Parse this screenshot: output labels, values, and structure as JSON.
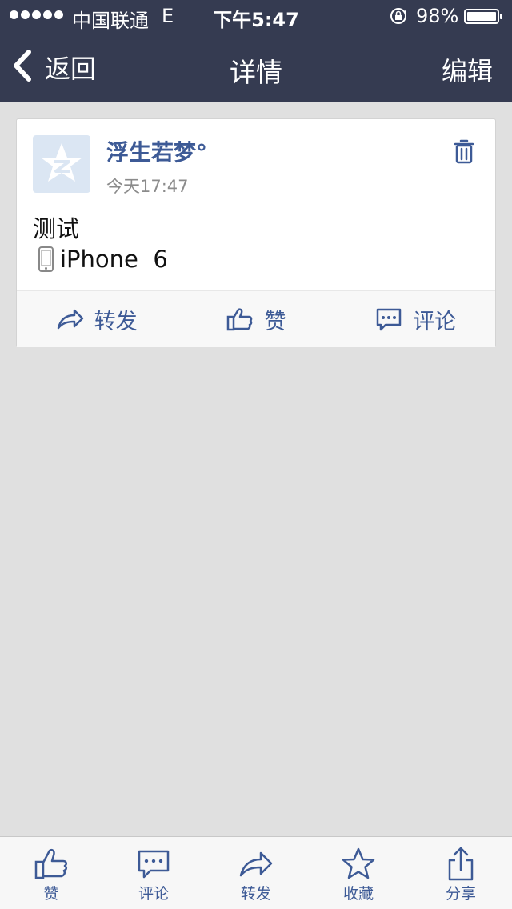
{
  "status_bar": {
    "carrier": "中国联通",
    "network": "E",
    "time": "下午5:47",
    "battery": "98%",
    "battery_level": 0.98
  },
  "nav": {
    "back_label": "返回",
    "title": "详情",
    "edit_label": "编辑"
  },
  "post": {
    "username": "浮生若梦°",
    "time": "今天17:47",
    "content": "测试",
    "device": "iPhone  6",
    "actions": {
      "forward": "转发",
      "like": "赞",
      "comment": "评论"
    }
  },
  "tabbar": {
    "like": "赞",
    "comment": "评论",
    "forward": "转发",
    "favorite": "收藏",
    "share": "分享"
  },
  "colors": {
    "header_bg": "#353b51",
    "accent": "#3d5a96",
    "page_bg": "#e0e0e0"
  }
}
